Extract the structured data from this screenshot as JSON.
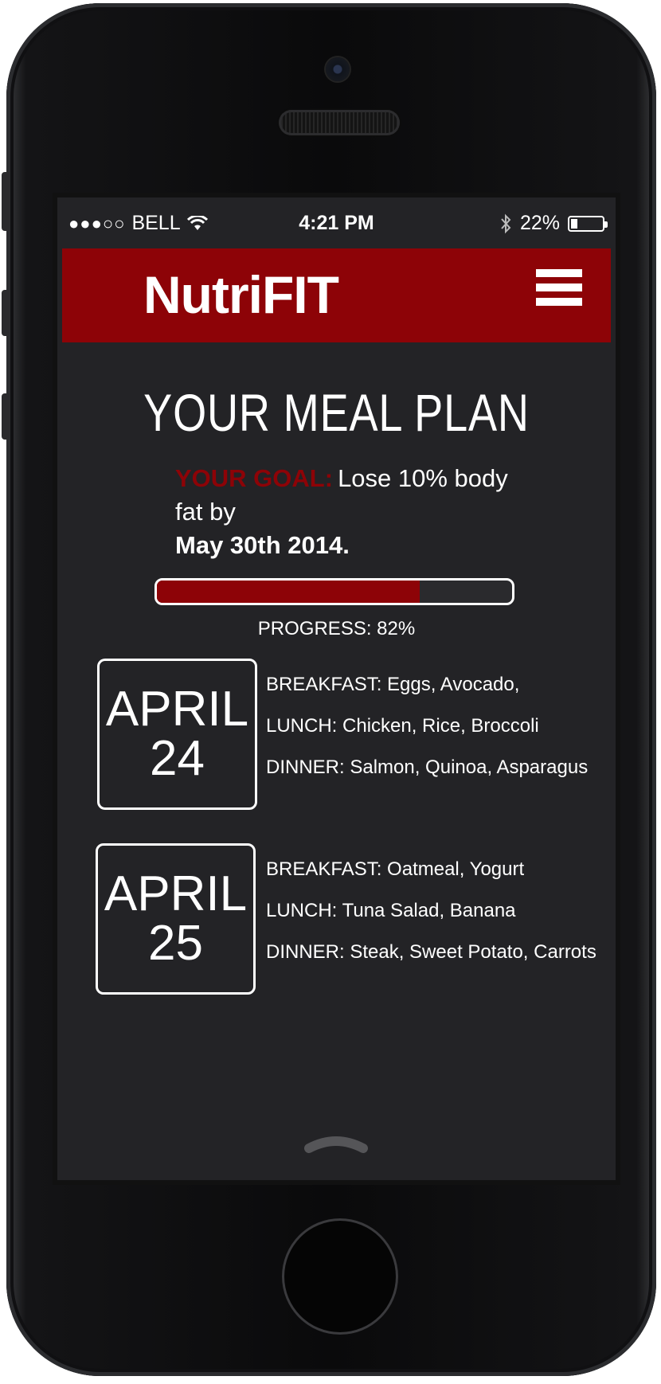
{
  "status_bar": {
    "signal": "●●●○○",
    "carrier": "BELL",
    "time": "4:21 PM",
    "battery": "22%",
    "battery_level": 0.22
  },
  "header": {
    "logo": "NutriFIT",
    "menu_icon": "hamburger-menu-icon"
  },
  "main": {
    "title": "YOUR MEAL PLAN",
    "goal_label": "YOUR GOAL:",
    "goal_text": "Lose 10% body fat by",
    "goal_date": "May 30th 2014.",
    "progress_text": "PROGRESS: 82%",
    "progress_value": 0.74
  },
  "days": [
    {
      "month": "APRIL",
      "day": "24",
      "breakfast": "BREAKFAST: Eggs, Avocado,",
      "lunch": "LUNCH: Chicken, Rice, Broccoli",
      "dinner": "DINNER: Salmon, Quinoa, Asparagus"
    },
    {
      "month": "APRIL",
      "day": "25",
      "breakfast": "BREAKFAST: Oatmeal, Yogurt",
      "lunch": "LUNCH: Tuna Salad, Banana",
      "dinner": "DINNER: Steak, Sweet Potato, Carrots"
    }
  ],
  "colors": {
    "accent": "#8d0307",
    "background": "#232326",
    "text": "#ffffff"
  }
}
